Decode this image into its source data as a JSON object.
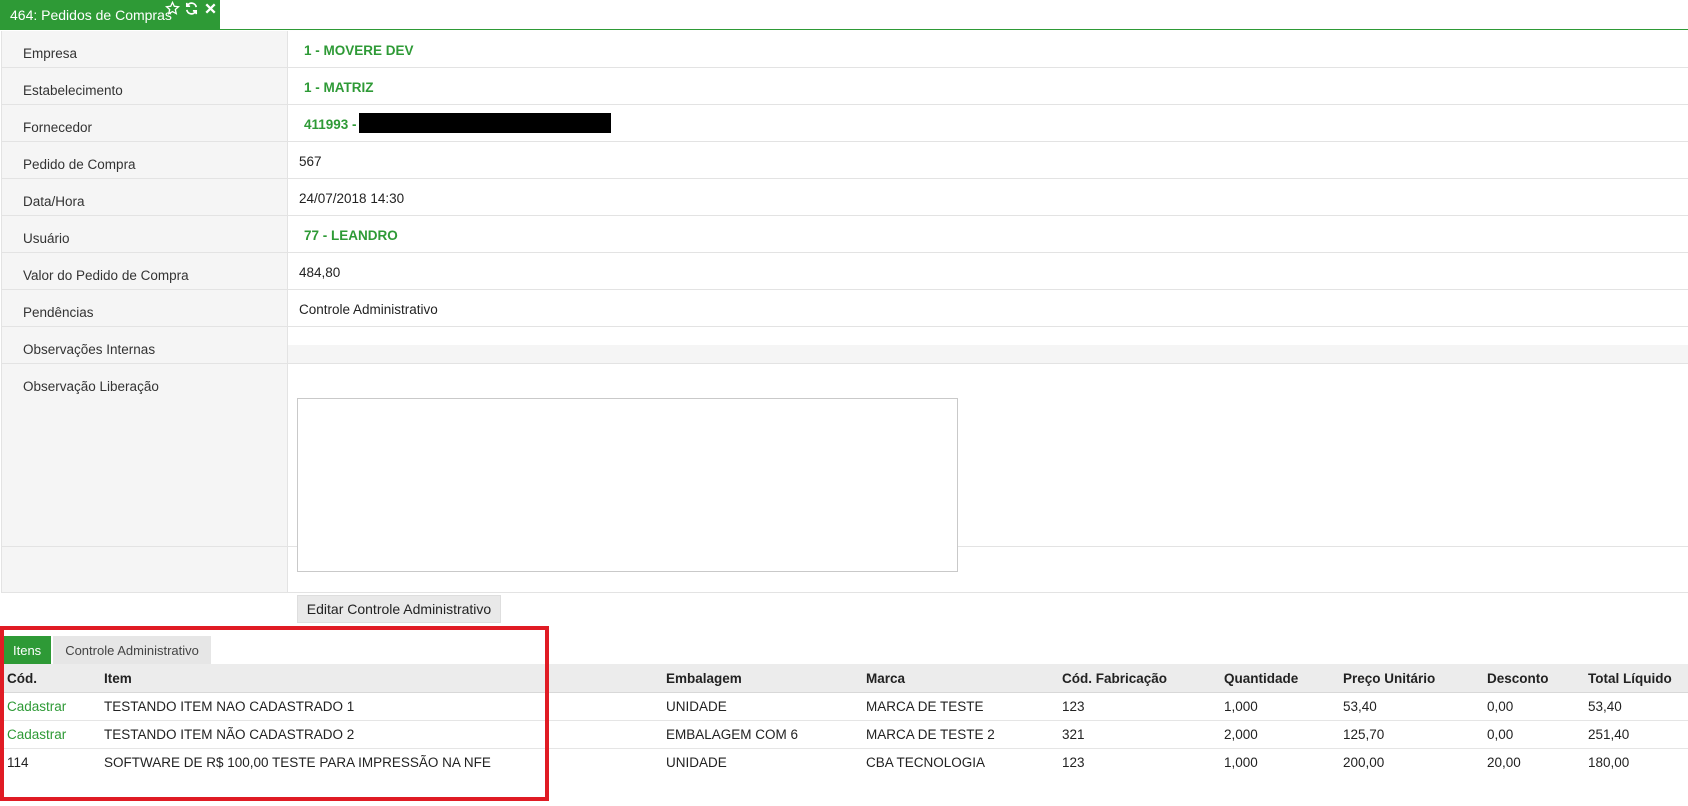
{
  "tab": {
    "title": "464: Pedidos de Compras",
    "icons": [
      "star-icon",
      "refresh-icon",
      "close-icon"
    ]
  },
  "colors": {
    "accent": "#2e9a36",
    "highlight": "#e01b24"
  },
  "form": {
    "empresa": {
      "label": "Empresa",
      "value": "1 - MOVERE DEV"
    },
    "estabelecimento": {
      "label": "Estabelecimento",
      "value": "1 - MATRIZ"
    },
    "fornecedor": {
      "label": "Fornecedor",
      "value": "411993 -"
    },
    "pedido": {
      "label": "Pedido de Compra",
      "value": "567"
    },
    "data": {
      "label": "Data/Hora",
      "value": "24/07/2018 14:30"
    },
    "usuario": {
      "label": "Usuário",
      "value": "77 - LEANDRO"
    },
    "valor": {
      "label": "Valor do Pedido de Compra",
      "value": "484,80"
    },
    "pendencias": {
      "label": "Pendências",
      "value": "Controle Administrativo"
    },
    "obs_internas": {
      "label": "Observações Internas",
      "value": ""
    },
    "obs_liberacao": {
      "label": "Observação Liberação",
      "value": ""
    }
  },
  "edit_button": "Editar Controle Administrativo",
  "subtabs": [
    "Itens",
    "Controle Administrativo"
  ],
  "table": {
    "headers": [
      "Cód.",
      "Item",
      "Embalagem",
      "Marca",
      "Cód. Fabricação",
      "Quantidade",
      "Preço Unitário",
      "Desconto",
      "Total Líquido"
    ],
    "rows": [
      [
        "Cadastrar",
        "TESTANDO ITEM NAO CADASTRADO 1",
        "UNIDADE",
        "MARCA DE TESTE",
        "123",
        "1,000",
        "53,40",
        "0,00",
        "53,40"
      ],
      [
        "Cadastrar",
        "TESTANDO ITEM NÃO CADASTRADO 2",
        "EMBALAGEM COM 6",
        "MARCA DE TESTE 2",
        "321",
        "2,000",
        "125,70",
        "0,00",
        "251,40"
      ],
      [
        "114",
        "SOFTWARE DE R$ 100,00 TESTE PARA IMPRESSÃO NA NFE",
        "UNIDADE",
        "CBA TECNOLOGIA",
        "123",
        "1,000",
        "200,00",
        "20,00",
        "180,00"
      ]
    ]
  }
}
